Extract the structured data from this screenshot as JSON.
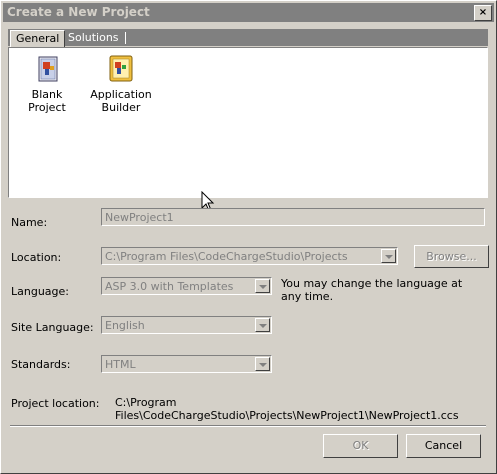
{
  "window": {
    "title": "Create a New Project",
    "close_glyph": "×"
  },
  "tabs": [
    {
      "label": "General"
    },
    {
      "label": "Solutions"
    }
  ],
  "projects": [
    {
      "label": "Blank Project",
      "icon": "blank-project-icon"
    },
    {
      "label": "Application Builder",
      "icon": "application-builder-icon"
    }
  ],
  "form": {
    "name_label": "Name:",
    "name_value": "NewProject1",
    "location_label": "Location:",
    "location_value": "C:\\Program Files\\CodeChargeStudio\\Projects",
    "browse_label": "Browse...",
    "language_label": "Language:",
    "language_value": "ASP 3.0 with Templates",
    "language_note": "You may change the language at any time.",
    "site_language_label": "Site Language:",
    "site_language_value": "English",
    "standards_label": "Standards:",
    "standards_value": "HTML",
    "project_location_label": "Project location:",
    "project_location_value": "C:\\Program Files\\CodeChargeStudio\\Projects\\NewProject1\\NewProject1.ccs"
  },
  "buttons": {
    "ok_label": "OK",
    "cancel_label": "Cancel"
  }
}
